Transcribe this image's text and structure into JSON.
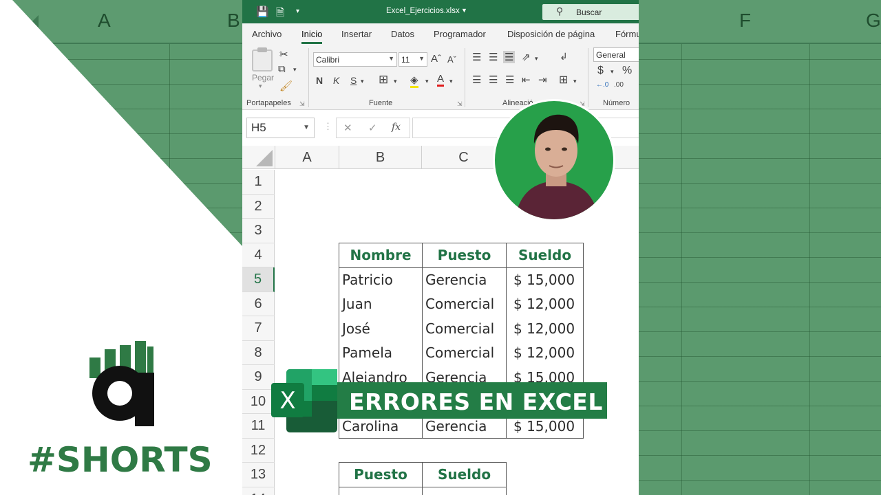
{
  "background": {
    "columns": [
      "A",
      "B",
      "F",
      "G"
    ],
    "color": "#5b9a6e"
  },
  "brand": {
    "shorts_label": "#SHORTS",
    "accent": "#2f7a45"
  },
  "titlebar": {
    "filename": "Excel_Ejercicios.xlsx",
    "search_label": "Buscar",
    "color": "#217346"
  },
  "ribbon_tabs": [
    "Archivo",
    "Inicio",
    "Insertar",
    "Datos",
    "Programador",
    "Disposición de página",
    "Fórmu"
  ],
  "ribbon": {
    "paste_label": "Pegar",
    "font_name": "Calibri",
    "font_size": "11",
    "bold": "N",
    "italic": "K",
    "underline": "S",
    "number_format": "General",
    "currency_symbol": "$",
    "percent_symbol": "%",
    "groups": {
      "clipboard": "Portapapeles",
      "font": "Fuente",
      "alignment": "Alineació",
      "number": "Número"
    }
  },
  "formula_bar": {
    "name_box": "H5",
    "fx": "fx",
    "value": ""
  },
  "sheet": {
    "columns": [
      "A",
      "B",
      "C"
    ],
    "rows": [
      "1",
      "2",
      "3",
      "4",
      "5",
      "6",
      "7",
      "8",
      "9",
      "10",
      "11",
      "12",
      "13",
      "14"
    ],
    "selected_row": "5"
  },
  "table_main": {
    "headers": [
      "Nombre",
      "Puesto",
      "Sueldo"
    ],
    "rows": [
      [
        "Patricio",
        "Gerencia",
        "$ 15,000"
      ],
      [
        "Juan",
        "Comercial",
        "$ 12,000"
      ],
      [
        "José",
        "Comercial",
        "$ 12,000"
      ],
      [
        "Pamela",
        "Comercial",
        "$ 12,000"
      ],
      [
        "Alejandro",
        "Gerencia",
        "$ 15,000"
      ],
      [
        "",
        "",
        ""
      ],
      [
        "Carolina",
        "Gerencia",
        "$ 15,000"
      ]
    ]
  },
  "table_summary": {
    "headers": [
      "Puesto",
      "Sueldo"
    ]
  },
  "overlay": {
    "banner_text": "ERRORES EN EXCEL",
    "excel_logo_letter": "X",
    "avatar_color": "#27a04a"
  }
}
